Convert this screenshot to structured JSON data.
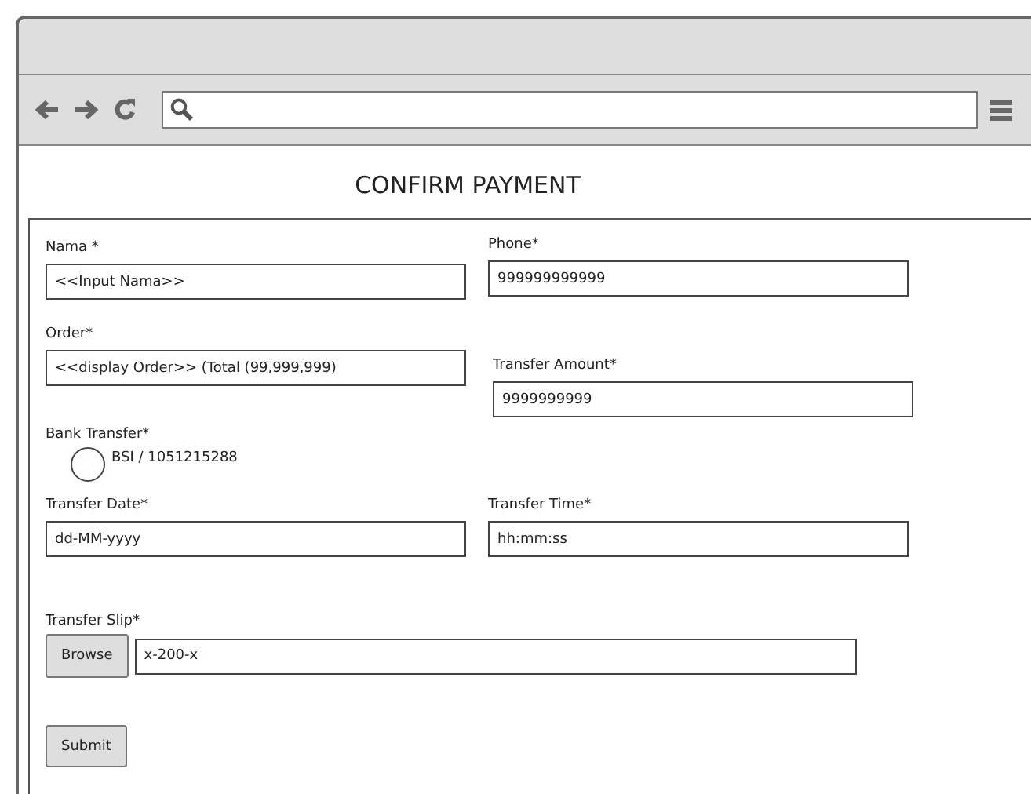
{
  "heading": "CONFIRM PAYMENT",
  "form": {
    "name": {
      "label": "Nama *",
      "value": "<<Input Nama>>"
    },
    "phone": {
      "label": "Phone*",
      "value": "999999999999"
    },
    "order": {
      "label": "Order*",
      "value": "<<display Order>> (Total (99,999,999)"
    },
    "amount": {
      "label": "Transfer Amount*",
      "value": "9999999999"
    },
    "bank": {
      "label": "Bank Transfer*",
      "options": [
        {
          "label": "BSI / 1051215288",
          "selected": false
        }
      ]
    },
    "date": {
      "label": "Transfer Date*",
      "value": "dd-MM-yyyy"
    },
    "time": {
      "label": "Transfer Time*",
      "value": "hh:mm:ss"
    },
    "slip": {
      "label": "Transfer Slip*",
      "button": "Browse",
      "value": "x-200-x"
    },
    "submit": "Submit"
  }
}
